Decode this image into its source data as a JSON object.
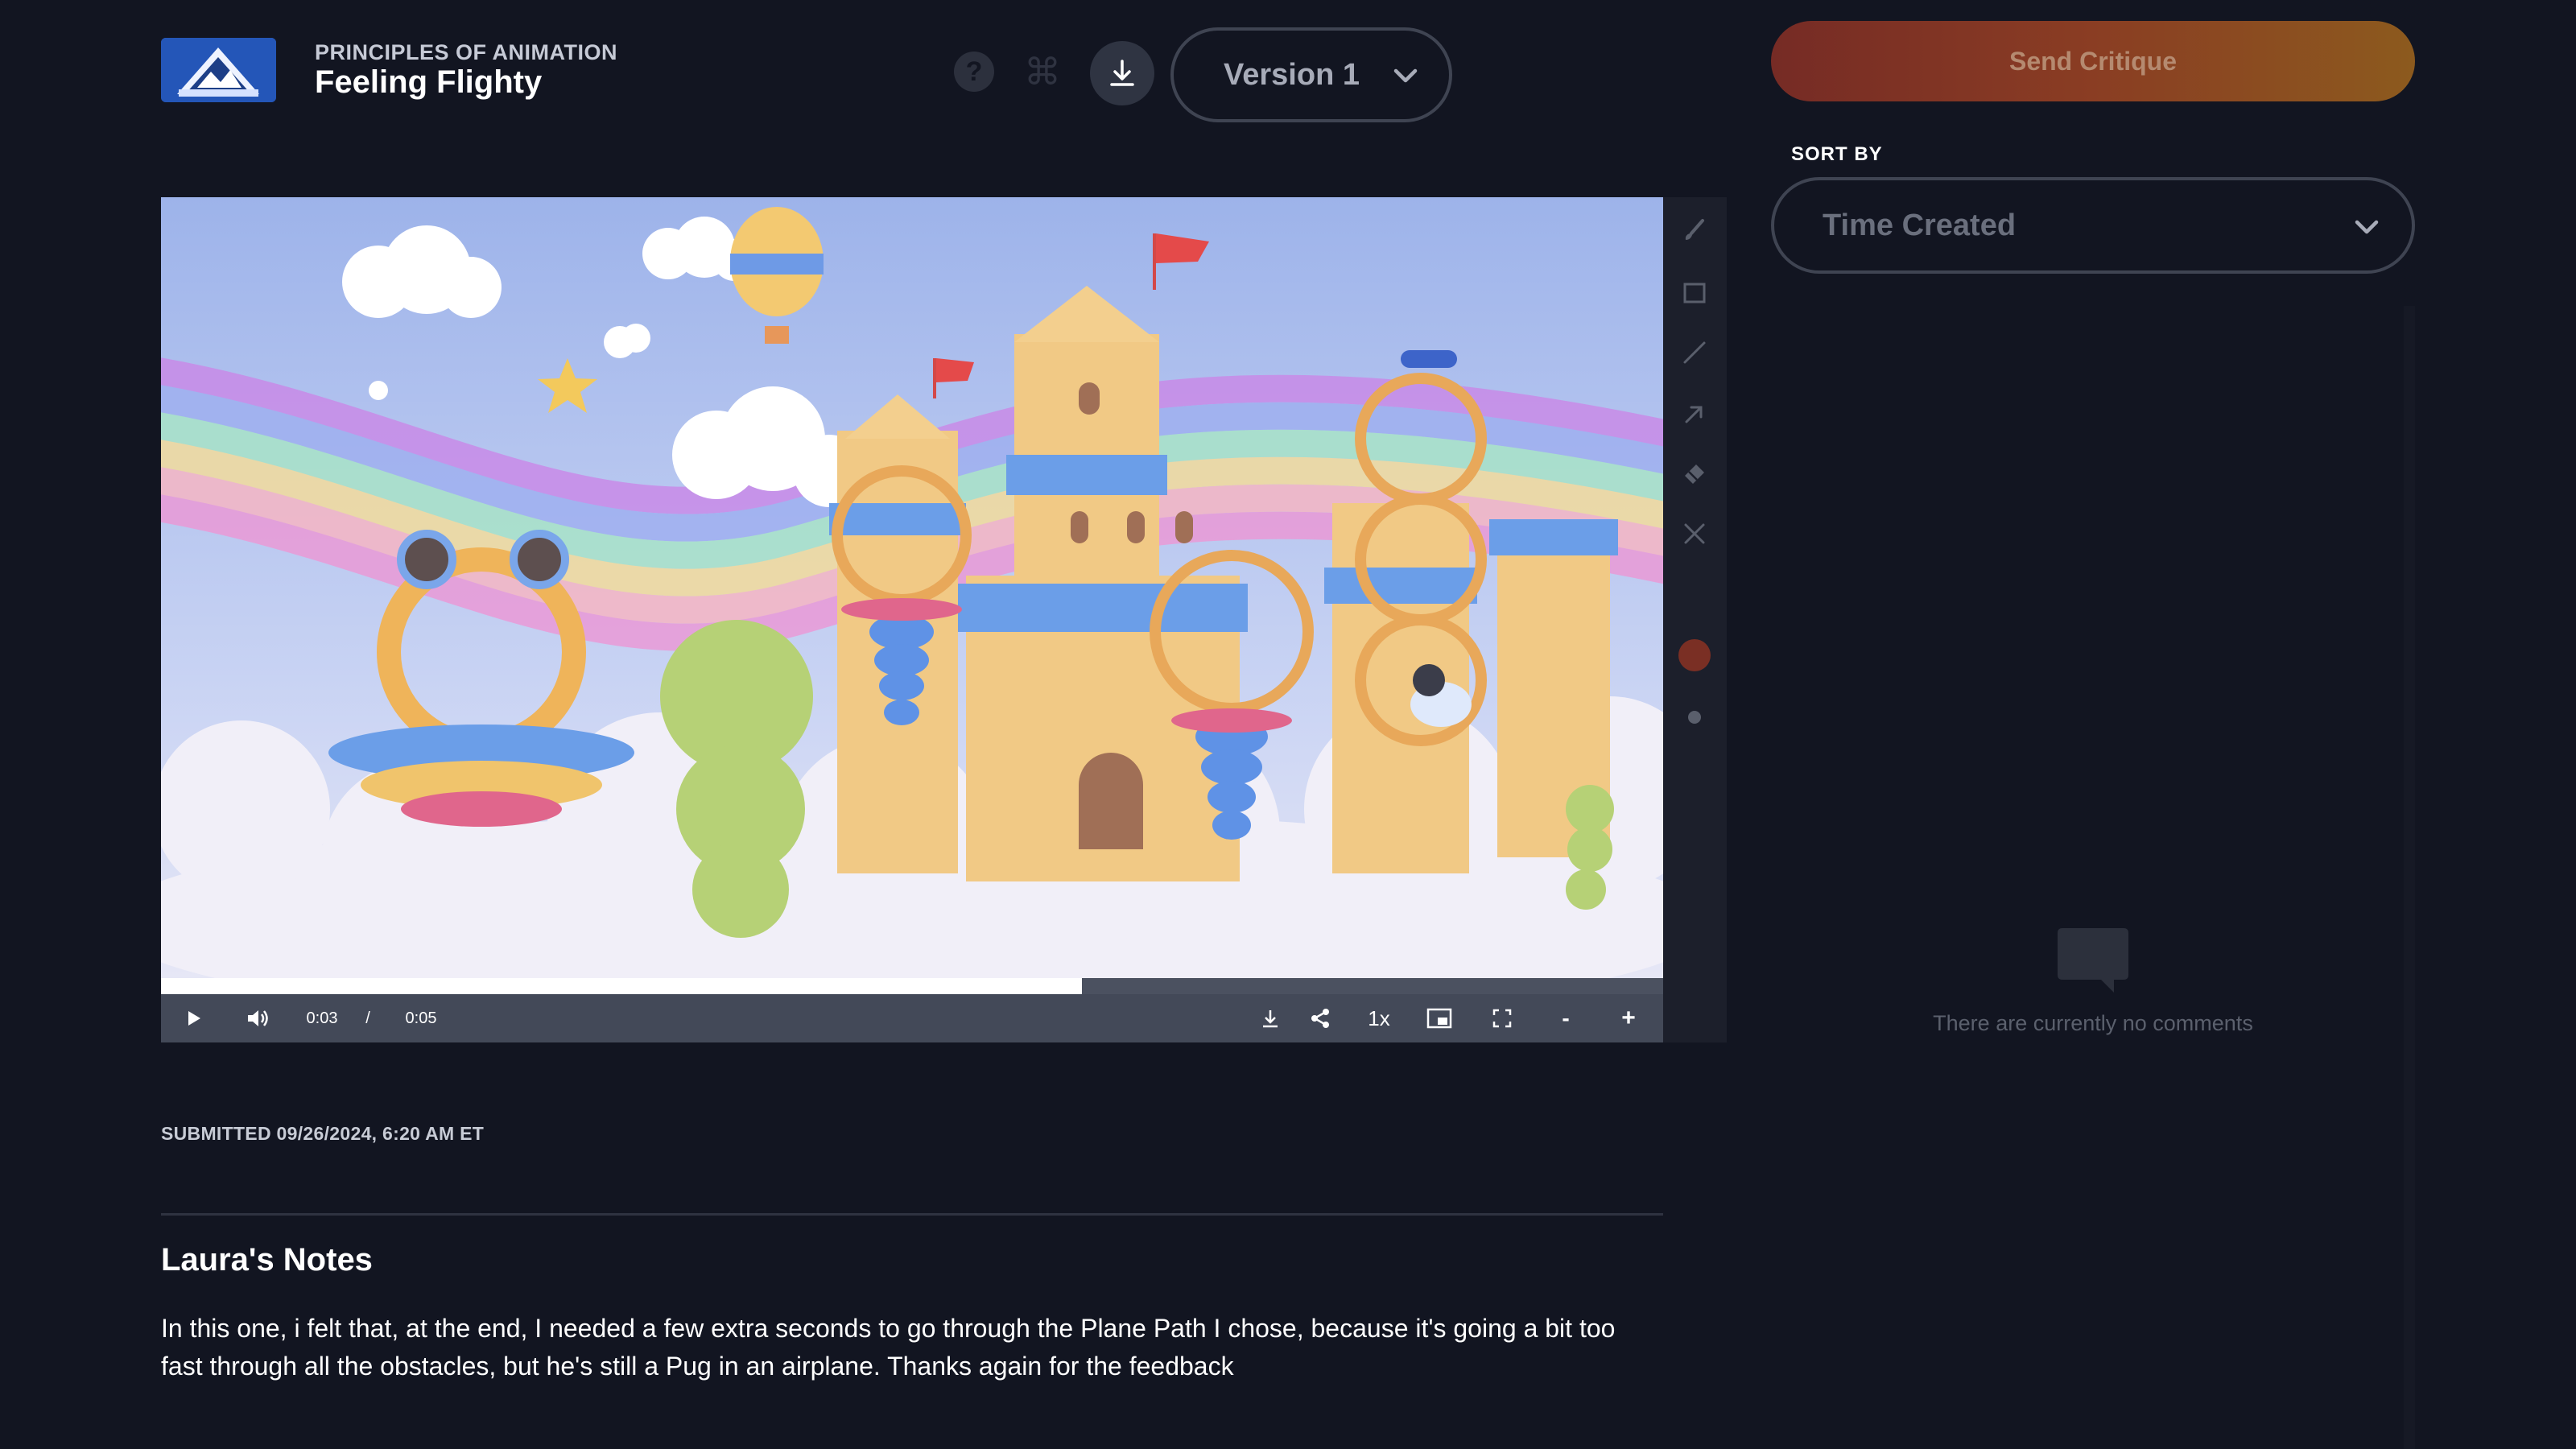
{
  "header": {
    "course": "PRINCIPLES OF ANIMATION",
    "project": "Feeling Flighty",
    "version_label": "Version 1"
  },
  "critique": {
    "send_label": "Send Critique",
    "sort_label": "SORT BY",
    "sort_value": "Time Created"
  },
  "player": {
    "current_time": "0:03",
    "separator": "/",
    "duration": "0:05",
    "speed": "1x",
    "zoom_out": "-",
    "zoom_in": "+",
    "progress": 0.613
  },
  "tools": {
    "icons": [
      "brush-icon",
      "rectangle-icon",
      "line-icon",
      "arrow-icon",
      "eraser-icon",
      "clear-icon"
    ],
    "color": "#7a2f24"
  },
  "submission": {
    "submitted": "SUBMITTED 09/26/2024, 6:20 AM ET",
    "notes_title": "Laura's Notes",
    "notes_body": "In this one, i felt that, at the end, I needed a few extra seconds to go through the Plane Path I chose, because it's going a bit too fast through all the obstacles, but he's still a Pug in an airplane. Thanks again for the feedback"
  },
  "comments": {
    "empty_message": "There are currently no comments"
  },
  "colors": {
    "background": "#121521",
    "accent_start": "#762b25",
    "accent_end": "#8c5a1e"
  }
}
